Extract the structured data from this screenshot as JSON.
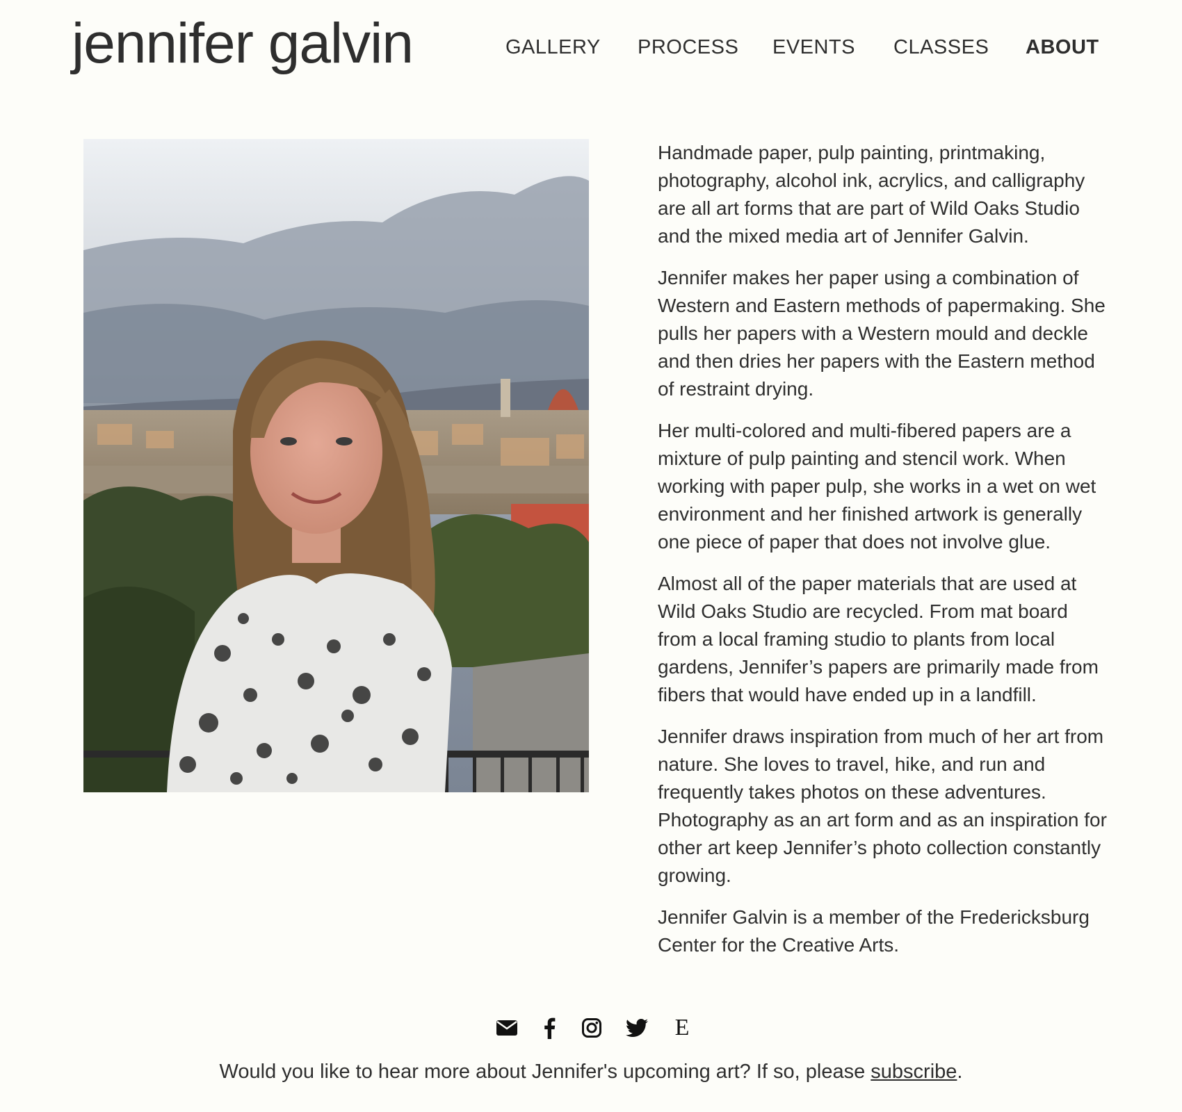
{
  "header": {
    "site_title": "jennifer galvin",
    "nav": [
      {
        "label": "GALLERY",
        "active": false
      },
      {
        "label": "PROCESS",
        "active": false
      },
      {
        "label": "EVENTS",
        "active": false
      },
      {
        "label": "CLASSES",
        "active": false
      },
      {
        "label": "ABOUT",
        "active": true
      }
    ]
  },
  "bio": {
    "paragraphs": [
      "Handmade paper, pulp painting, printmaking, photography, alcohol ink, acrylics, and calligraphy are all art forms that are part of Wild Oaks Studio and the mixed media art of Jennifer Galvin.",
      "Jennifer makes her paper using a combination of Western and Eastern methods of papermaking. She pulls her papers with a Western mould and deckle and then dries her papers with the Eastern method of restraint drying.",
      "Her multi-colored and multi-fibered papers are a mixture of pulp painting and stencil work. When working with paper pulp, she works in a wet on wet environment and her finished artwork is generally one piece of paper that does not involve glue.",
      "Almost all of the paper materials that are used at Wild Oaks Studio are recycled. From mat board from a local framing studio to plants from local gardens, Jennifer’s papers are primarily made from fibers that would have ended up in a landfill.",
      "Jennifer draws inspiration from much of her art from nature. She loves to travel, hike, and run and frequently takes photos on these adventures. Photography as an art form and as an inspiration for other art keep Jennifer’s photo collection constantly growing.",
      "Jennifer Galvin is a member of the Fredericksburg Center for the Creative Arts."
    ]
  },
  "footer": {
    "social_icons": [
      "envelope-icon",
      "facebook-icon",
      "instagram-icon",
      "twitter-icon",
      "etsy-icon"
    ],
    "etsy_letter": "E",
    "subscribe_prefix": "Would you like to hear more about Jennifer's upcoming art? If so, please ",
    "subscribe_link": "subscribe",
    "subscribe_suffix": "."
  },
  "colors": {
    "background": "#fdfdf9",
    "text": "#2e2e2e"
  }
}
